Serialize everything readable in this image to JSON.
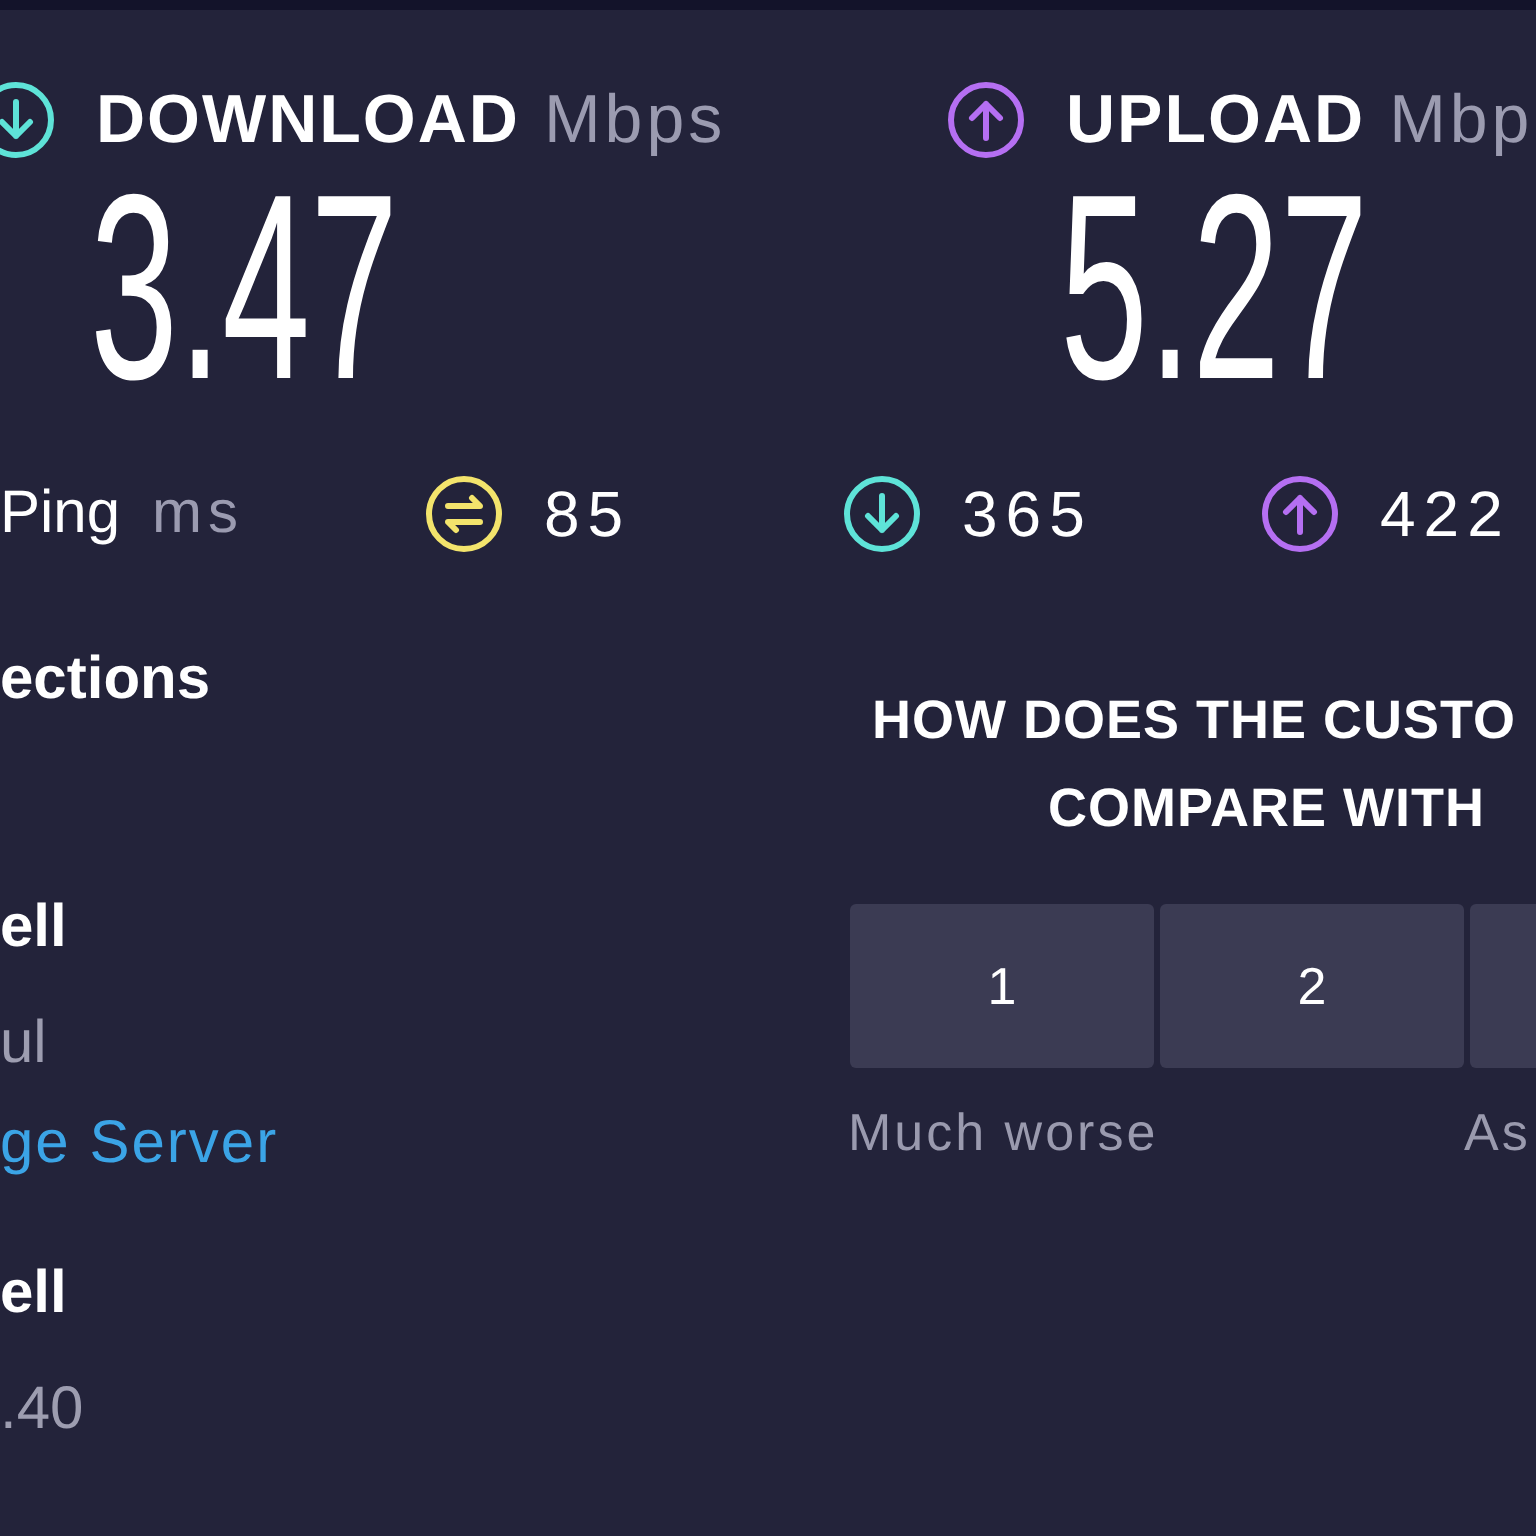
{
  "results": [
    {
      "kind": "download",
      "label": "DOWNLOAD",
      "unit": "Mbps",
      "value": "3.47"
    },
    {
      "kind": "upload",
      "label": "UPLOAD",
      "unit": "Mbp",
      "value": "5.27"
    }
  ],
  "ping": {
    "label": "Ping",
    "unit": "ms",
    "stats": [
      {
        "kind": "idle",
        "value": "85"
      },
      {
        "kind": "download",
        "value": "365"
      },
      {
        "kind": "upload",
        "value": "422"
      }
    ]
  },
  "connections": {
    "title": "ections",
    "items": [
      {
        "kind": "name",
        "text": "ell"
      },
      {
        "kind": "detail",
        "text": "ul"
      },
      {
        "kind": "link",
        "text": "ge Server"
      },
      {
        "kind": "name",
        "text": "ell"
      },
      {
        "kind": "detail",
        "text": ".40"
      }
    ]
  },
  "survey": {
    "question_lines": [
      "HOW DOES THE CUSTO",
      "COMPARE WITH"
    ],
    "options": [
      {
        "kind": "number",
        "label": "1"
      },
      {
        "kind": "number",
        "label": "2"
      },
      {
        "kind": "clipped"
      }
    ],
    "scale_labels": [
      "Much worse",
      "As"
    ]
  }
}
